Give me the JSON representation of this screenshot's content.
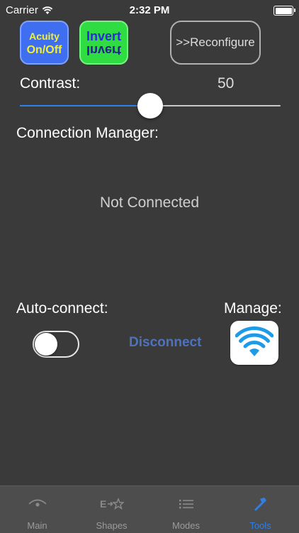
{
  "status_bar": {
    "carrier": "Carrier",
    "time": "2:32 PM"
  },
  "toolbar": {
    "acuity_line1": "Acuity",
    "acuity_line2": "On/Off",
    "invert_line1": "Invert",
    "invert_line2": "Invert",
    "reconfigure_label": ">>Reconfigure"
  },
  "contrast": {
    "label": "Contrast:",
    "value": "50",
    "fraction": 0.5
  },
  "connection": {
    "title": "Connection Manager:",
    "status": "Not Connected",
    "auto_connect_label": "Auto-connect:",
    "auto_connect_on": false,
    "manage_label": "Manage:",
    "disconnect_label": "Disconnect"
  },
  "tabs": [
    {
      "label": "Main",
      "icon": "eye-icon",
      "active": false
    },
    {
      "label": "Shapes",
      "icon": "shapes-icon",
      "active": false
    },
    {
      "label": "Modes",
      "icon": "list-icon",
      "active": false
    },
    {
      "label": "Tools",
      "icon": "tools-icon",
      "active": true
    }
  ],
  "colors": {
    "background": "#3a3a3a",
    "accent": "#2f7fe6",
    "acuity_bg": "#3f6ff0",
    "acuity_text": "#f3f22a",
    "invert_bg": "#2fdc42",
    "disconnect_text": "#4f73bb",
    "wifi_icon": "#1e9be8"
  }
}
